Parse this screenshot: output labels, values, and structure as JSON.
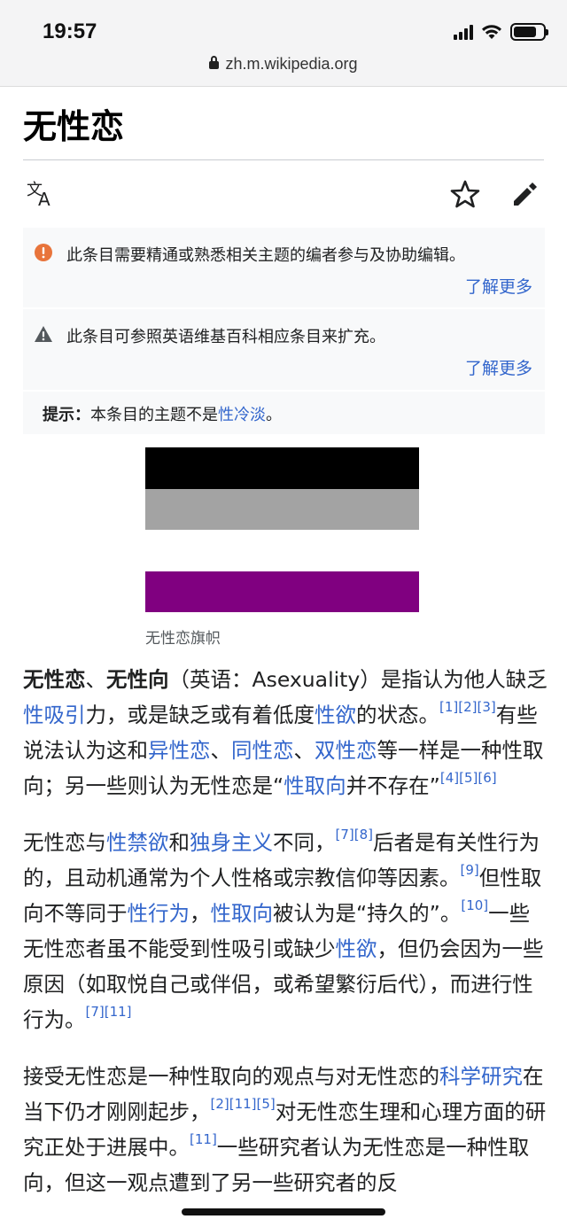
{
  "status_bar": {
    "time": "19:57"
  },
  "browser": {
    "url": "zh.m.wikipedia.org"
  },
  "article": {
    "title": "无性恋"
  },
  "icons": {
    "language": "translate-icon",
    "watch": "star-icon",
    "edit": "pencil-icon"
  },
  "notices": [
    {
      "text": "此条目需要精通或熟悉相关主题的编者参与及协助编辑。",
      "link": "了解更多",
      "icon": "error-circle-icon",
      "color": "#e8743b"
    },
    {
      "text": "此条目可参照英语维基百科相应条目来扩充。",
      "link": "了解更多",
      "icon": "warning-triangle-icon"
    }
  ],
  "hatnote": {
    "label": "提示：",
    "text": "本条目的主题不是",
    "link": "性冷淡",
    "suffix": "。"
  },
  "flag": {
    "colors": [
      "#000000",
      "#a3a3a3",
      "#ffffff",
      "#800080"
    ],
    "caption": "无性恋旗帜"
  },
  "paragraphs": {
    "p1": {
      "b1": "无性恋",
      "s1": "、",
      "b2": "无性向",
      "s2": "（英语：Asexuality）是指认为他人缺乏",
      "l1": "性吸引",
      "s3": "力，或是缺乏或有着低度",
      "l2": "性欲",
      "s4": "的状态。",
      "r1": "[1][2][3]",
      "s5": "有些说法认为这和",
      "l3": "异性恋",
      "s6": "、",
      "l4": "同性恋",
      "s7": "、",
      "l5": "双性恋",
      "s8": "等一样是一种性取向；另一些则认为无性恋是“",
      "l6": "性取向",
      "s9": "并不存在”",
      "r2": "[4][5][6]"
    },
    "p2": {
      "s1": "无性恋与",
      "l1": "性禁欲",
      "s2": "和",
      "l2": "独身主义",
      "s3": "不同，",
      "r1": "[7][8]",
      "s4": "后者是有关性行为的，且动机通常为个人性格或宗教信仰等因素。",
      "r2": "[9]",
      "s5": "但性取向不等同于",
      "l3": "性行为",
      "s6": "，",
      "l4": "性取向",
      "s7": "被认为是“持久的”。",
      "r3": "[10]",
      "s8": "一些无性恋者虽不能受到性吸引或缺少",
      "l5": "性欲",
      "s9": "，但仍会因为一些原因（如取悦自己或伴侣，或希望繁衍后代），而进行性行为。",
      "r4": "[7][11]"
    },
    "p3": {
      "s1": "接受无性恋是一种性取向的观点与对无性恋的",
      "l1": "科学研究",
      "s2": "在当下仍才刚刚起步，",
      "r1": "[2][11][5]",
      "s3": "对无性恋生理和心理方面的研究正处于进展中。",
      "r2": "[11]",
      "s4": "一些研究者认为无性恋是一种性取向，但这一观点遭到了另一些研究者的反"
    }
  }
}
